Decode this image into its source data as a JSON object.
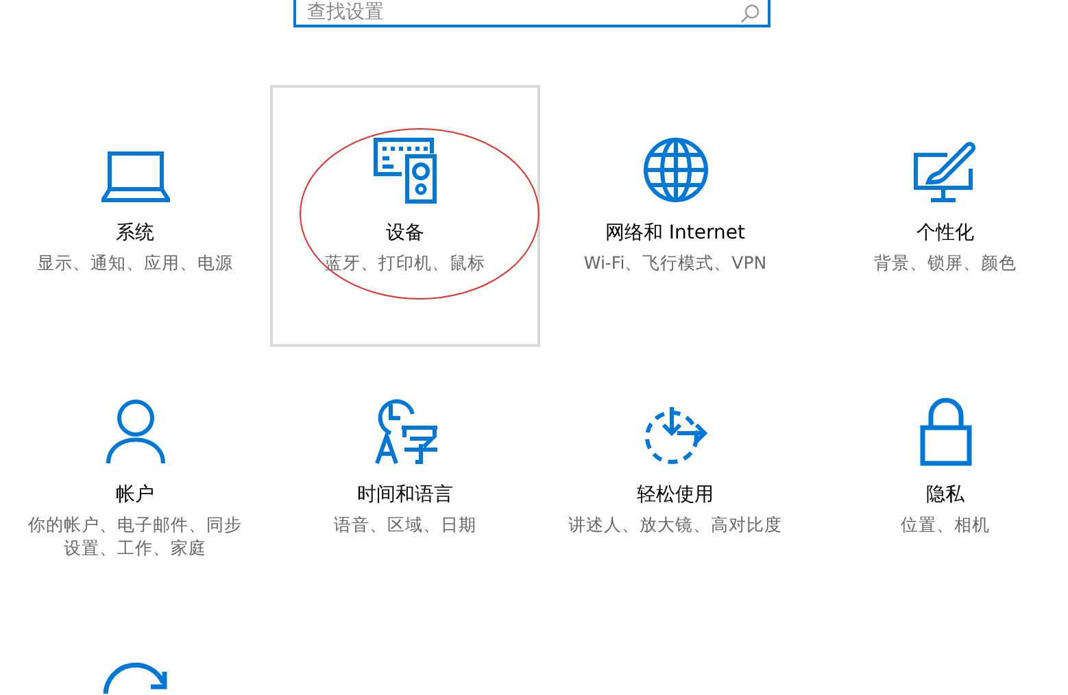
{
  "search": {
    "placeholder": "查找设置"
  },
  "tiles": [
    {
      "kind": "system",
      "title": "系统",
      "subtitle": "显示、通知、应用、电源",
      "hovered": false,
      "circled": false
    },
    {
      "kind": "devices",
      "title": "设备",
      "subtitle": "蓝牙、打印机、鼠标",
      "hovered": true,
      "circled": true
    },
    {
      "kind": "network",
      "title": "网络和 Internet",
      "subtitle": "Wi-Fi、飞行模式、VPN",
      "hovered": false,
      "circled": false
    },
    {
      "kind": "personalization",
      "title": "个性化",
      "subtitle": "背景、锁屏、颜色",
      "hovered": false,
      "circled": false
    },
    {
      "kind": "accounts",
      "title": "帐户",
      "subtitle": "你的帐户、电子邮件、同步设置、工作、家庭",
      "hovered": false,
      "circled": false
    },
    {
      "kind": "time",
      "title": "时间和语言",
      "subtitle": "语音、区域、日期",
      "hovered": false,
      "circled": false
    },
    {
      "kind": "ease",
      "title": "轻松使用",
      "subtitle": "讲述人、放大镜、高对比度",
      "hovered": false,
      "circled": false
    },
    {
      "kind": "privacy",
      "title": "隐私",
      "subtitle": "位置、相机",
      "hovered": false,
      "circled": false
    },
    {
      "kind": "update",
      "hovered": false,
      "circled": false
    }
  ]
}
